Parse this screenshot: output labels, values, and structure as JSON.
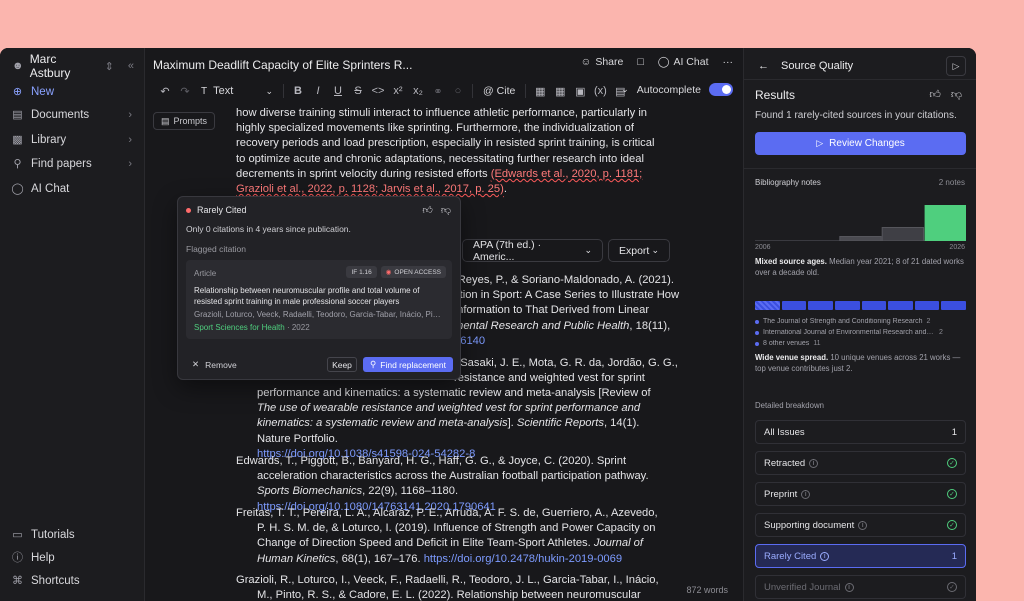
{
  "sidebar": {
    "user": "Marc Astbury",
    "items": [
      {
        "label": "New"
      },
      {
        "label": "Documents"
      },
      {
        "label": "Library"
      },
      {
        "label": "Find papers"
      },
      {
        "label": "AI Chat"
      }
    ],
    "footer": [
      {
        "label": "Tutorials"
      },
      {
        "label": "Help"
      },
      {
        "label": "Shortcuts"
      }
    ]
  },
  "editor": {
    "title": "Maximum Deadlift Capacity of Elite Sprinters R...",
    "share": "Share",
    "ai_chat": "AI Chat",
    "text_style": "Text",
    "cite": "Cite",
    "autocomplete": "Autocomplete",
    "prompts": "Prompts",
    "para_text": "how diverse training stimuli interact to influence athletic performance, particularly in highly specialized movements like sprinting. Furthermore, the individualization of recovery periods and load prescription, especially in resisted sprint training, is critical to optimize acute and chronic adaptations, necessitating further research into ideal decrements in sprint velocity during resisted efforts ",
    "para_cite": "(Edwards et al., 2020, p. 1181; Grazioli et al., 2022, p. 1128; Jarvis et al., 2017, p. 25)",
    "para_end": ".",
    "style_select": "APA (7th ed.) · Americ...",
    "export": "Export",
    "ref1_l1": "-Reyes, P., & Soriano-Maldonado, A. (2021).",
    "ref1_l2": "ction in Sport: A Case Series to Illustrate How",
    "ref1_l3": "Information to That Derived from Linear",
    "ref1_l4_i": "mental Research and Public Health",
    "ref1_l4_r": ", 18(11),",
    "ref1_link": "16140",
    "ref2_l1": ", Sasaki, J. E., Mota, G. R. da, Jordão, G. G.,",
    "ref2_l2": "resistance and weighted vest for sprint",
    "ref2_l3": "performance and kinematics: a systematic review and meta-analysis [Review of ",
    "ref2_l3_i": "The use",
    "ref2_l4_i": "of wearable resistance and weighted vest for sprint performance and kinematics: a systematic review and meta-analysis",
    "ref2_l5_r": "]. ",
    "ref2_l5_i": "Scientific Reports",
    "ref2_l5_e": ", 14(1). Nature Portfolio.",
    "ref2_link": "https://doi.org/10.1038/s41598-024-54282-8",
    "ref3_a": "Edwards, T., Piggott, B., Banyard, H. G., Haff, G. G., & Joyce, C. (2020). Sprint acceleration characteristics across the Australian football participation pathway. ",
    "ref3_i": "Sports Biomechanics",
    "ref3_b": ", 22(9), 1168–1180. ",
    "ref3_link": "https://doi.org/10.1080/14763141.2020.1790641",
    "ref4_a": "Freitas, T. T., Pereira, L. A., Alcaráz, P. E., Arruda, A. F. S. de, Guerriero, A., Azevedo, P. H. S. M. de, & Loturco, I. (2019). Influence of Strength and Power Capacity on Change of Direction Speed and Deficit in Elite Team-Sport Athletes. ",
    "ref4_i": "Journal of Human Kinetics",
    "ref4_b": ", 68(1), 167–176. ",
    "ref4_link": "https://doi.org/10.2478/hukin-2019-0069",
    "ref5_a": "Grazioli, R., Loturco, I., Veeck, F., Radaelli, R., Teodoro, J. L., Garcia-Tabar, I., Inácio, M., Pinto, R. S., & Cadore, E. L. (2022). Relationship between neuromuscular profile and total volume",
    "word_count": "872 words"
  },
  "popup": {
    "status": "Rarely Cited",
    "desc": "Only 0 citations in 4 years since publication.",
    "flagged": "Flagged citation",
    "kind": "Article",
    "if_tag": "IF 1.16",
    "oa_tag": "OPEN ACCESS",
    "art_title": "Relationship between neuromuscular profile and total volume of resisted sprint training in male professional soccer players",
    "authors": "Grazioli, Loturco, Veeck, Radaelli, Teodoro, Garcia-Tabar, Inácio, Pinto, Cadore",
    "journal": "Sport Sciences for Health",
    "year": "· 2022",
    "remove": "Remove",
    "keep": "Keep",
    "find": "Find replacement"
  },
  "rpanel": {
    "title": "Source Quality",
    "results": "Results",
    "found": "Found 1 rarely-cited sources in your citations.",
    "review": "Review Changes",
    "bib": "Bibliography notes",
    "bib_n": "2 notes",
    "ax_l": "2006",
    "ax_r": "2026",
    "note1_b": "Mixed source ages.",
    "note1": " Median year 2021; 8 of 21 dated works over a decade old.",
    "venues": [
      {
        "name": "The Journal of Strength and Conditioning Research",
        "count": "2"
      },
      {
        "name": "International Journal of Environmental Research and Pu...",
        "count": "2"
      },
      {
        "name": "8 other venues",
        "count": "11"
      }
    ],
    "note2_b": "Wide venue spread.",
    "note2": " 10 unique venues across 21 works — top venue contributes just 2.",
    "detail": "Detailed breakdown",
    "rows": [
      {
        "label": "All Issues",
        "count": "1"
      },
      {
        "label": "Retracted"
      },
      {
        "label": "Preprint"
      },
      {
        "label": "Supporting document"
      },
      {
        "label": "Rarely Cited",
        "count": "1"
      },
      {
        "label": "Unverified Journal"
      }
    ]
  },
  "chart_data": {
    "type": "bar",
    "title": "",
    "x": [
      "2006",
      "2026"
    ],
    "values": [
      0,
      0,
      1,
      3,
      8
    ],
    "xlabel": "",
    "ylabel": ""
  },
  "colors": {
    "accent": "#5b6cf2",
    "success": "#4fcf7e",
    "error": "#ff6b6b"
  }
}
